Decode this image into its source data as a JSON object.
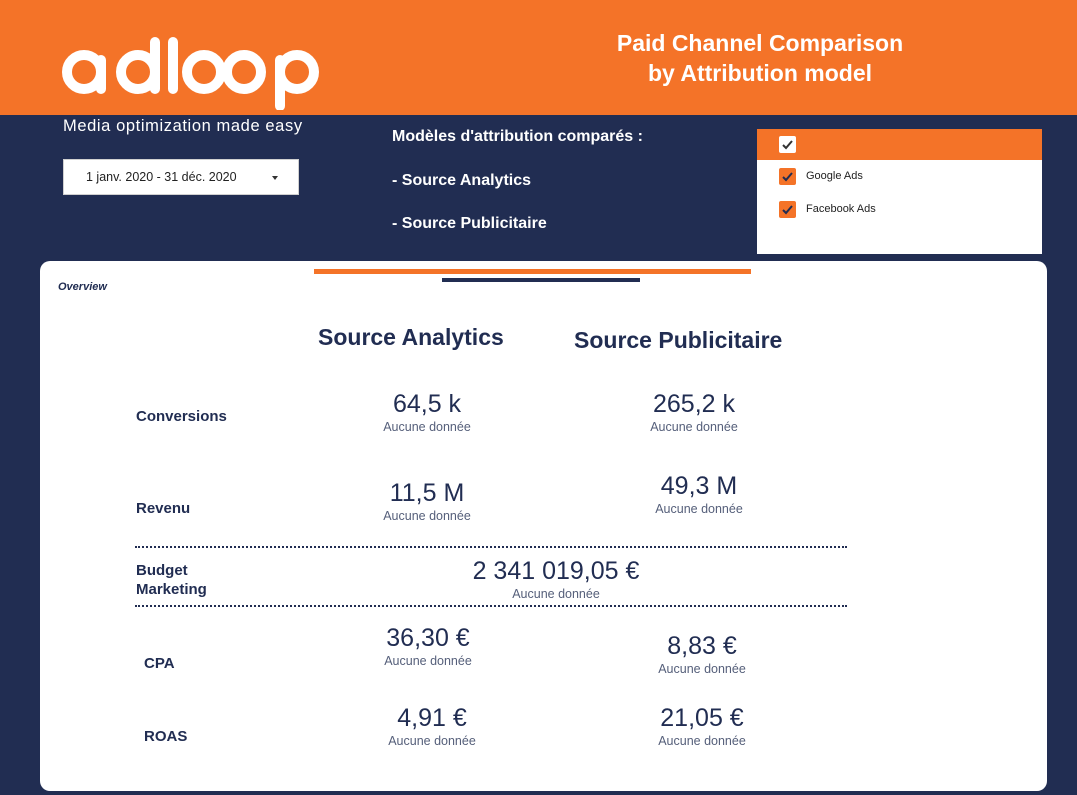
{
  "header": {
    "logo_text": "adloop",
    "tagline": "Media optimization made easy",
    "title_line1": "Paid Channel Comparison",
    "title_line2": "by Attribution model"
  },
  "date_range": {
    "label": "1 janv. 2020 - 31 déc. 2020"
  },
  "attribution": {
    "heading": "Modèles d'attribution comparés :",
    "item1": "- Source Analytics",
    "item2": "- Source Publicitaire"
  },
  "filter": {
    "options": [
      {
        "label": "Google Ads",
        "checked": true
      },
      {
        "label": "Facebook Ads",
        "checked": true
      }
    ]
  },
  "overview": {
    "label": "Overview",
    "col_analytics": "Source Analytics",
    "col_publicitaire": "Source Publicitaire",
    "rows": {
      "conversions": {
        "label": "Conversions",
        "analytics": "64,5 k",
        "analytics_sub": "Aucune donnée",
        "publicitaire": "265,2 k",
        "publicitaire_sub": "Aucune donnée"
      },
      "revenu": {
        "label": "Revenu",
        "analytics": "11,5 M",
        "analytics_sub": "Aucune donnée",
        "publicitaire": "49,3 M",
        "publicitaire_sub": "Aucune donnée"
      },
      "budget": {
        "label_line1": "Budget",
        "label_line2": "Marketing",
        "value": "2 341 019,05 €",
        "sub": "Aucune donnée"
      },
      "cpa": {
        "label": "CPA",
        "analytics": "36,30 €",
        "analytics_sub": "Aucune donnée",
        "publicitaire": "8,83 €",
        "publicitaire_sub": "Aucune donnée"
      },
      "roas": {
        "label": "ROAS",
        "analytics": "4,91 €",
        "analytics_sub": "Aucune donnée",
        "publicitaire": "21,05 €",
        "publicitaire_sub": "Aucune donnée"
      }
    }
  },
  "colors": {
    "brand_orange": "#f47328",
    "navy": "#212d52",
    "white": "#ffffff"
  }
}
